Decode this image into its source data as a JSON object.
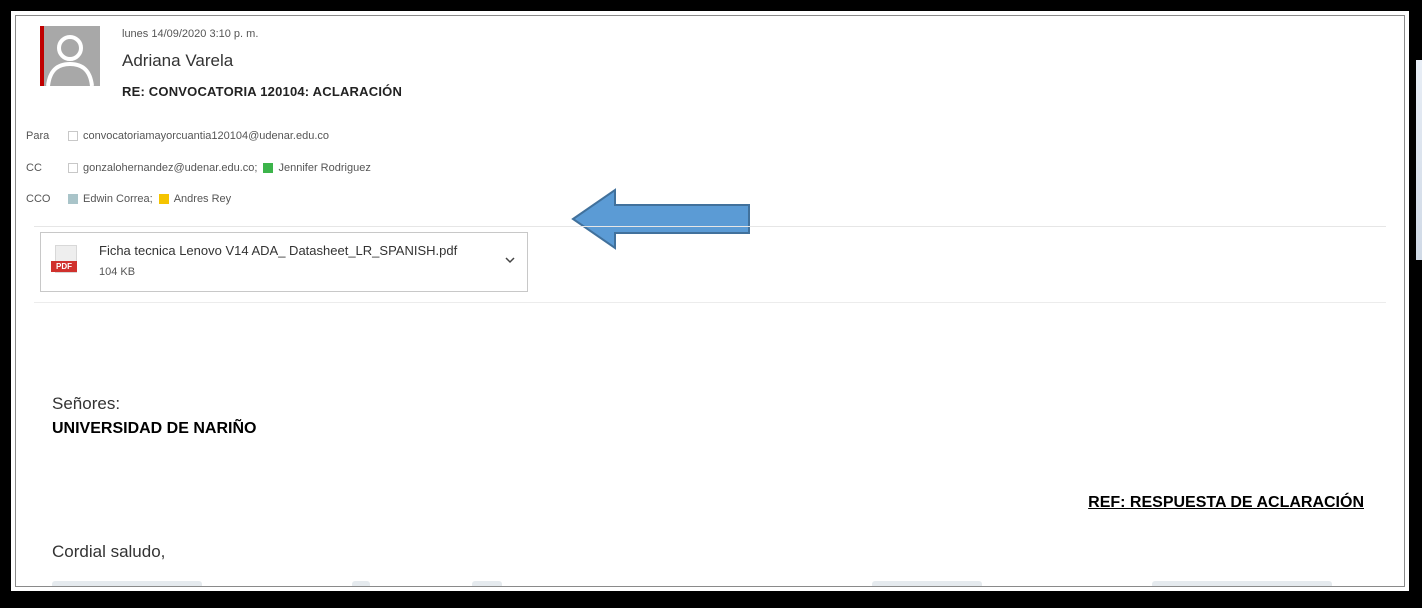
{
  "email": {
    "date": "lunes 14/09/2020 3:10 p. m.",
    "sender": "Adriana Varela",
    "subject": "RE: CONVOCATORIA 120104: ACLARACIÓN",
    "to_label": "Para",
    "to": [
      "convocatoriamayorcuantia120104@udenar.edu.co"
    ],
    "cc_label": "CC",
    "cc": [
      "gonzalohernandez@udenar.edu.co;",
      "Jennifer Rodriguez"
    ],
    "bcc_label": "CCO",
    "bcc": [
      "Edwin Correa;",
      "Andres Rey"
    ]
  },
  "attachment": {
    "filename": "Ficha tecnica Lenovo V14 ADA_ Datasheet_LR_SPANISH.pdf",
    "size": "104 KB",
    "type_tag": "PDF"
  },
  "body": {
    "greeting": "Señores:",
    "organization": "UNIVERSIDAD DE NARIÑO",
    "reference": "REF: RESPUESTA DE ACLARACIÓN",
    "salutation": "Cordial saludo,"
  },
  "colors": {
    "arrow": "#5b9bd5",
    "cc_jennifer": "#3cb44b",
    "bcc_edwin": "#a9c4c9",
    "bcc_andres": "#f5c400",
    "avatar_accent": "#c00000"
  },
  "icons": {
    "avatar": "person-silhouette-icon",
    "attachment": "pdf-file-icon",
    "expand": "chevron-down-icon",
    "annotation": "left-arrow-icon"
  }
}
